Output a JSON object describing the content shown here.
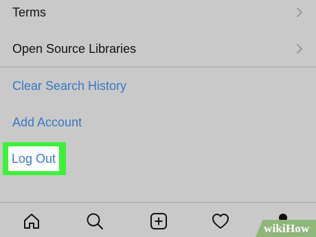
{
  "settings": {
    "terms_label": "Terms",
    "open_source_label": "Open Source Libraries",
    "clear_history_label": "Clear Search History",
    "add_account_label": "Add Account",
    "logout_label": "Log Out"
  },
  "tabbar": {
    "items": [
      {
        "icon": "home-icon"
      },
      {
        "icon": "search-icon"
      },
      {
        "icon": "add-post-icon"
      },
      {
        "icon": "heart-icon"
      },
      {
        "icon": "profile-icon"
      }
    ]
  },
  "watermark": {
    "text": "wikiHow"
  },
  "colors": {
    "background": "#c9c9c9",
    "link_blue": "#3b78c2",
    "highlight_green": "#3ff03a",
    "divider": "#a9a9a9"
  }
}
